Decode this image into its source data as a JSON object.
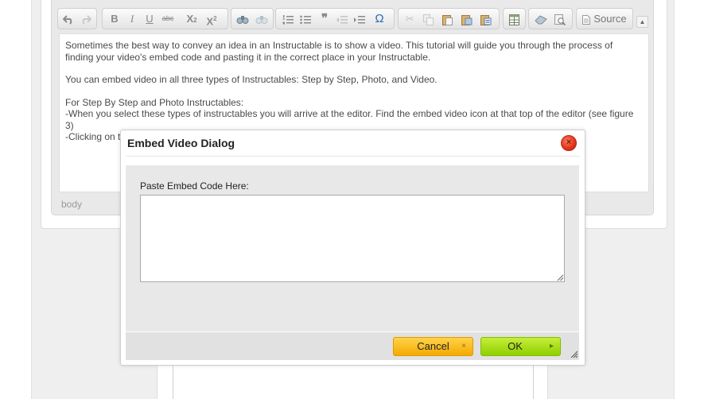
{
  "toolbar": {
    "source_label": "Source"
  },
  "editor": {
    "paragraphs": [
      "Sometimes the best way to convey an idea in an Instructable is to show a video.  This tutorial will guide you through the process of finding your video's embed code and pasting it in the correct place in your Instructable.",
      "You can embed video in all three types of Instructables: Step by Step, Photo, and Video.",
      "For Step By Step and Photo Instructables:"
    ],
    "line_1": "-When you select these types of instructables you will arrive at the editor.  Find the embed video icon at that top of the editor (see figure 3)",
    "line_2": "-Clicking on t",
    "status_path": "body"
  },
  "dialog": {
    "title": "Embed Video Dialog",
    "field_label": "Paste Embed Code Here:",
    "field_value": "",
    "cancel_label": "Cancel",
    "ok_label": "OK",
    "close_glyph": "×",
    "cancel_glyph": "×",
    "ok_glyph": "▸"
  },
  "colors": {
    "cancel_button": "#f5a900",
    "ok_button": "#8fcf00",
    "close_button": "#e0321a"
  }
}
